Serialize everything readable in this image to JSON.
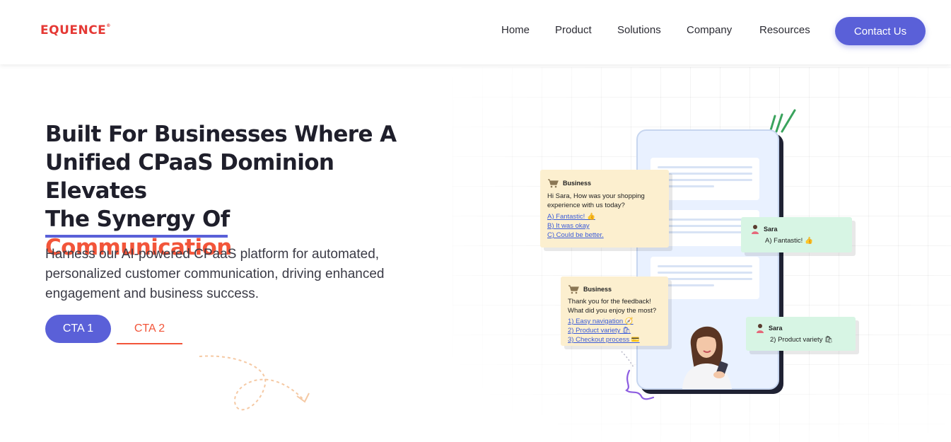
{
  "header": {
    "logo": "EQUENCE",
    "nav": [
      {
        "label": "Home"
      },
      {
        "label": "Product"
      },
      {
        "label": "Solutions"
      },
      {
        "label": "Company"
      },
      {
        "label": "Resources"
      }
    ],
    "contact_label": "Contact Us"
  },
  "hero": {
    "headline_line1": "Built For Businesses Where A",
    "headline_line2": "Unified CPaaS Dominion Elevates",
    "headline_line3": "The Synergy Of",
    "headline_accent": "Communication",
    "subtext": "Harness our AI-powered CPaaS platform for automated, personalized customer communication, driving enhanced engagement and business success.",
    "cta1": "CTA 1",
    "cta2": "CTA 2"
  },
  "chat": {
    "bubble1": {
      "sender": "Business",
      "message": "Hi Sara, How was your shopping experience with us today?",
      "options": [
        "A) Fantastic! 👍",
        "B) It was okay",
        "C) Could be better."
      ]
    },
    "bubble2": {
      "sender": "Sara",
      "message": "A) Fantastic! 👍"
    },
    "bubble3": {
      "sender": "Business",
      "message": "Thank you for the feedback! What did you enjoy the most?",
      "options": [
        "1) Easy navigation 🧭",
        "2) Product variety 🛍",
        "3) Checkout process 💳"
      ]
    },
    "bubble4": {
      "sender": "Sara",
      "message": "2) Product variety 🛍"
    }
  },
  "colors": {
    "brand_red": "#e53935",
    "accent_orange": "#f2553a",
    "primary_blue": "#5a60d8"
  }
}
